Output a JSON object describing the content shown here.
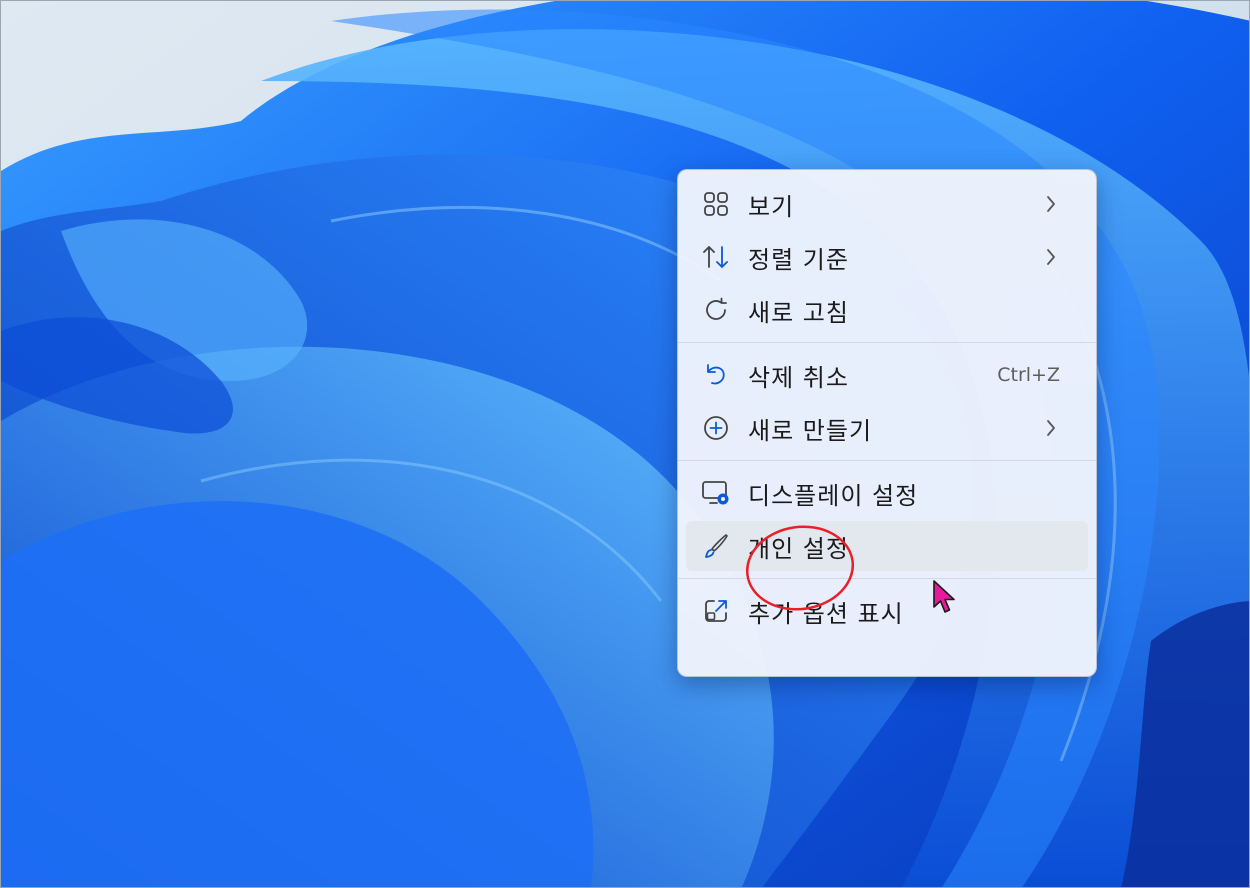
{
  "colors": {
    "accent": "#0a5bd6",
    "annotation": "#e8202a",
    "cursor": "#e8199a",
    "menu_bg": "#eef2fa",
    "hover_bg": "#e3e7ee"
  },
  "context_menu": {
    "groups": [
      {
        "items": [
          {
            "id": "view",
            "label": "보기",
            "icon": "grid-icon",
            "submenu": true
          },
          {
            "id": "sort-by",
            "label": "정렬 기준",
            "icon": "sort-icon",
            "submenu": true
          },
          {
            "id": "refresh",
            "label": "새로 고침",
            "icon": "refresh-icon",
            "submenu": false
          }
        ]
      },
      {
        "items": [
          {
            "id": "undo-delete",
            "label": "삭제 취소",
            "icon": "undo-icon",
            "shortcut": "Ctrl+Z"
          },
          {
            "id": "new",
            "label": "새로 만들기",
            "icon": "add-circle-icon",
            "submenu": true
          }
        ]
      },
      {
        "items": [
          {
            "id": "display-settings",
            "label": "디스플레이 설정",
            "icon": "display-settings-icon"
          },
          {
            "id": "personalize",
            "label": "개인 설정",
            "icon": "brush-icon",
            "hovered": true
          }
        ]
      },
      {
        "items": [
          {
            "id": "show-more-options",
            "label": "추가 옵션 표시",
            "icon": "open-external-icon"
          }
        ]
      }
    ]
  }
}
